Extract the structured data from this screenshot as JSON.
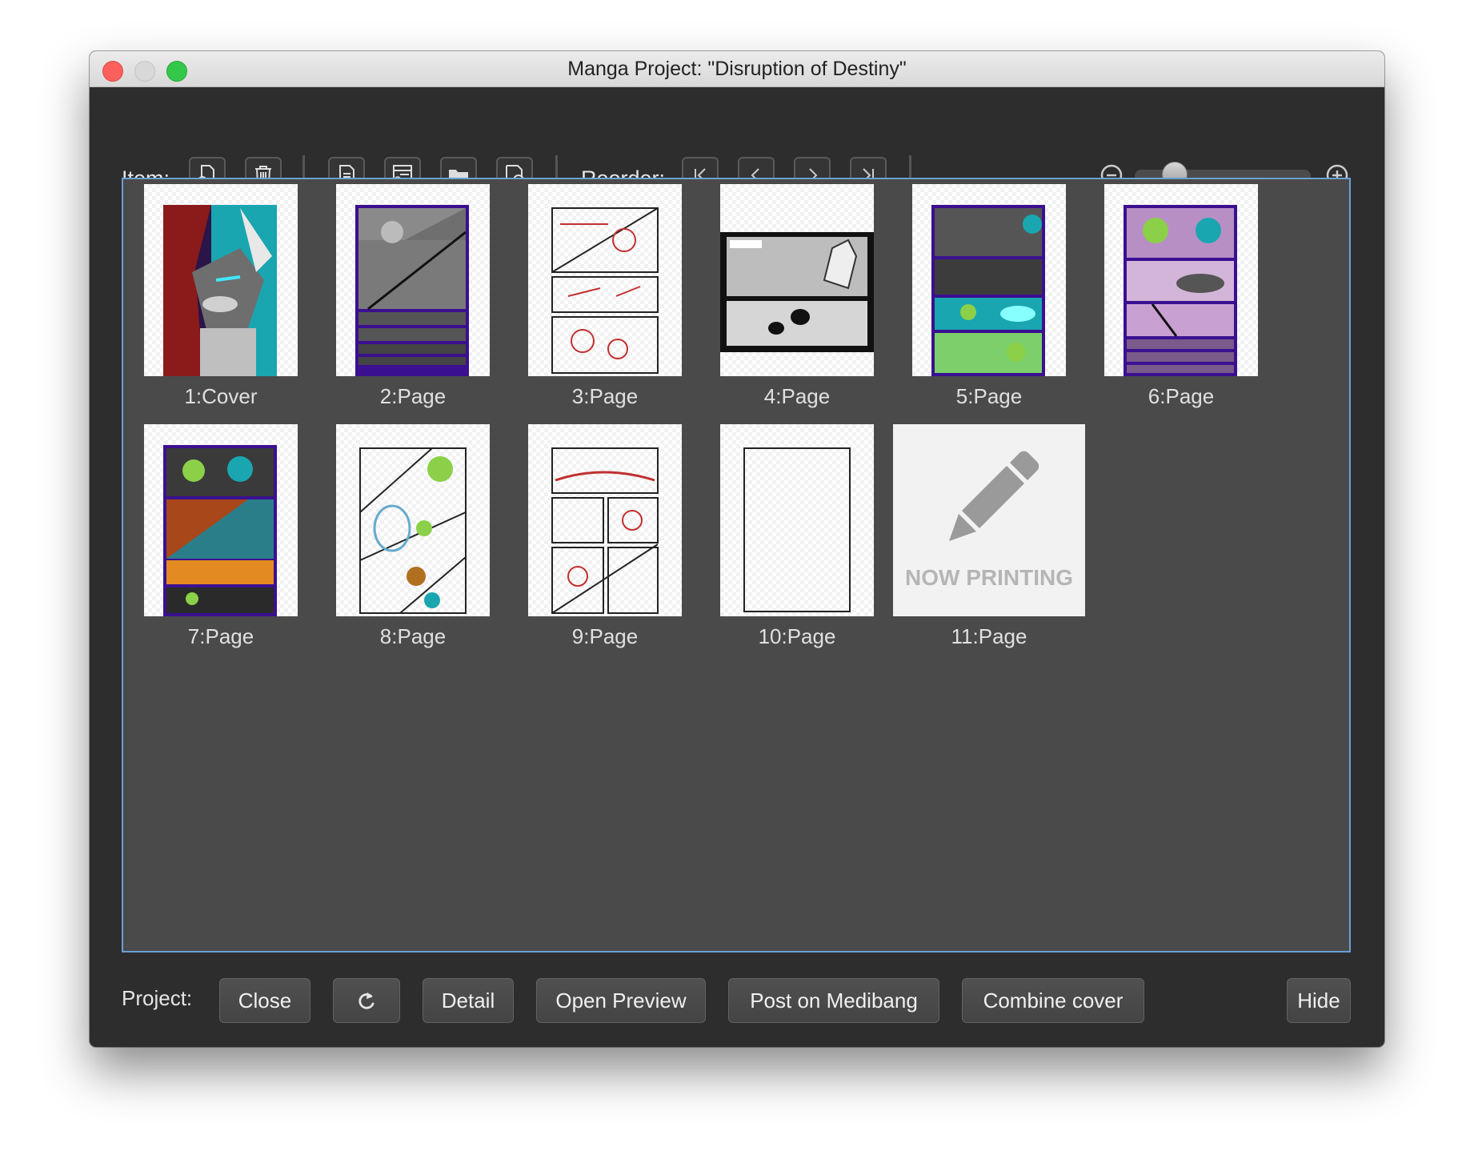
{
  "window": {
    "title": "Manga Project: \"Disruption of Destiny\""
  },
  "toolbar": {
    "item_label": "Item:",
    "reorder_label": "Reorder:",
    "item_buttons": [
      "add-page-icon",
      "trash-icon",
      "page-settings-icon",
      "page-history-icon",
      "open-folder-icon",
      "refresh-view-icon"
    ],
    "reorder_buttons": [
      "first-icon",
      "previous-icon",
      "next-icon",
      "last-icon"
    ],
    "zoom": {
      "level": 0.18
    }
  },
  "pages": [
    {
      "label": "1:Cover"
    },
    {
      "label": "2:Page"
    },
    {
      "label": "3:Page"
    },
    {
      "label": "4:Page"
    },
    {
      "label": "5:Page"
    },
    {
      "label": "6:Page"
    },
    {
      "label": "7:Page"
    },
    {
      "label": "8:Page"
    },
    {
      "label": "9:Page"
    },
    {
      "label": "10:Page"
    },
    {
      "label": "11:Page",
      "placeholder": "NOW PRINTING"
    }
  ],
  "footer": {
    "project_label": "Project:",
    "close_label": "Close",
    "detail_label": "Detail",
    "open_preview_label": "Open Preview",
    "post_label": "Post on Medibang",
    "combine_cover_label": "Combine cover",
    "hide_label": "Hide"
  }
}
